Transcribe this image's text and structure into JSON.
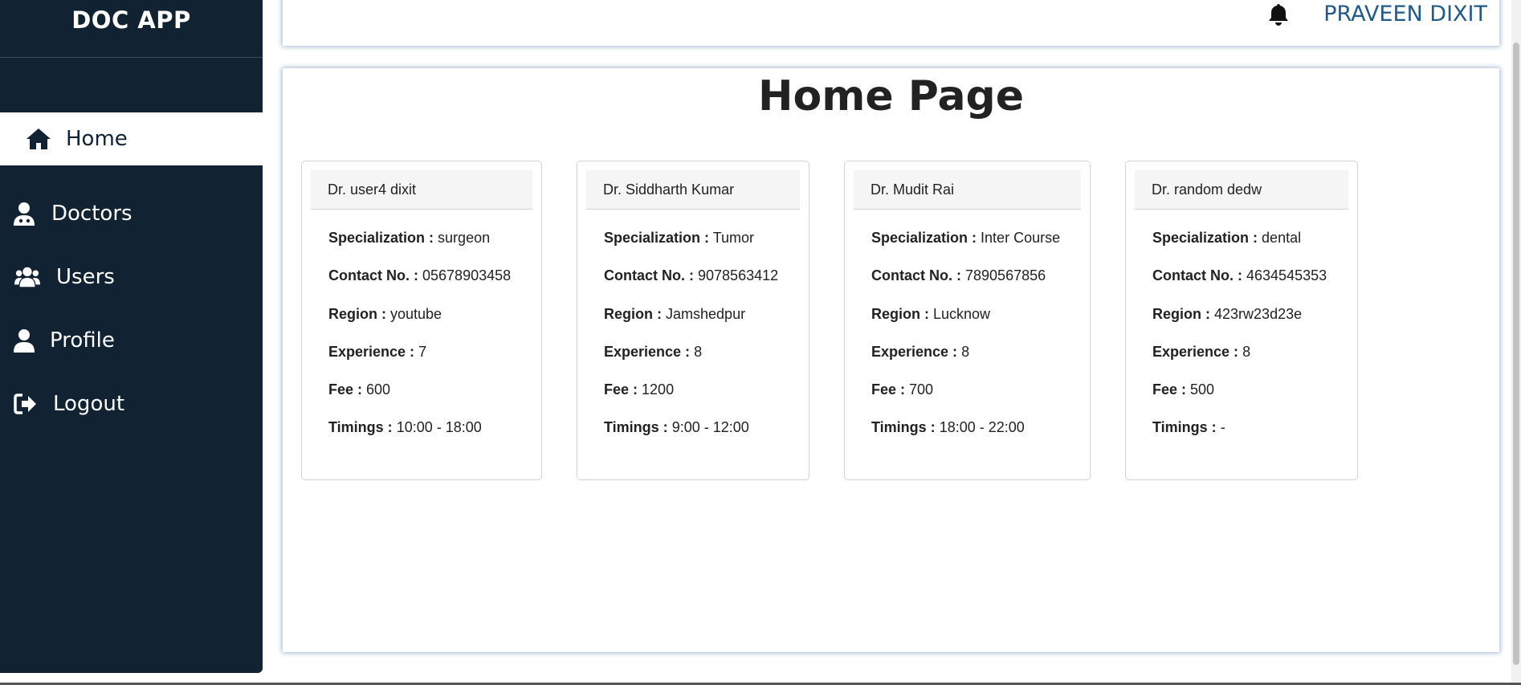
{
  "brand": {
    "title": "DOC APP"
  },
  "sidebar": {
    "items": [
      {
        "label": "Home",
        "icon": "home-icon",
        "active": true
      },
      {
        "label": "Doctors",
        "icon": "doctor-icon",
        "active": false
      },
      {
        "label": "Users",
        "icon": "users-icon",
        "active": false
      },
      {
        "label": "Profile",
        "icon": "user-icon",
        "active": false
      },
      {
        "label": "Logout",
        "icon": "logout-icon",
        "active": false
      }
    ]
  },
  "header": {
    "notification_icon": "bell-icon",
    "username": "PRAVEEN DIXIT"
  },
  "main": {
    "title": "Home Page",
    "labels": {
      "specialization": "Specialization :",
      "contact": "Contact No. :",
      "region": "Region :",
      "experience": "Experience :",
      "fee": "Fee :",
      "timings": "Timings :"
    },
    "doctors": [
      {
        "name": "Dr. user4 dixit",
        "specialization": "surgeon",
        "contact": "05678903458",
        "region": "youtube",
        "experience": "7",
        "fee": "600",
        "timings": "10:00 - 18:00"
      },
      {
        "name": "Dr. Siddharth Kumar",
        "specialization": "Tumor",
        "contact": "9078563412",
        "region": "Jamshedpur",
        "experience": "8",
        "fee": "1200",
        "timings": "9:00 - 12:00"
      },
      {
        "name": "Dr. Mudit Rai",
        "specialization": "Inter Course",
        "contact": "7890567856",
        "region": "Lucknow",
        "experience": "8",
        "fee": "700",
        "timings": "18:00 - 22:00"
      },
      {
        "name": "Dr. random dedw",
        "specialization": "dental",
        "contact": "4634545353",
        "region": "423rw23d23e",
        "experience": "8",
        "fee": "500",
        "timings": "-"
      }
    ]
  },
  "colors": {
    "sidebar_bg": "#112233",
    "accent_username": "#1f5a8a",
    "card_border": "#cfd3d7"
  }
}
